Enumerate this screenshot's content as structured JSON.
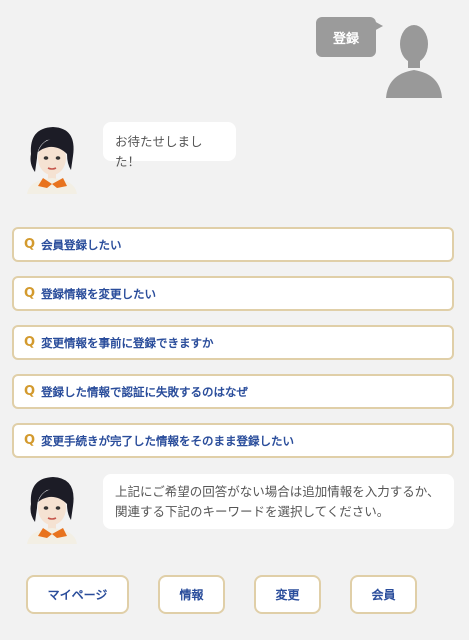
{
  "user_message": "登録",
  "bot_messages": [
    "お待たせしました！",
    "上記にご希望の回答がない場合は追加情報を入力するか、関連する下記のキーワードを選択してください。"
  ],
  "q_mark": "Q",
  "questions": [
    "会員登録したい",
    "登録情報を変更したい",
    "変更情報を事前に登録できますか",
    "登録した情報で認証に失敗するのはなぜ",
    "変更手続きが完了した情報をそのまま登録したい"
  ],
  "keywords": [
    "マイページ",
    "情報",
    "変更",
    "会員"
  ],
  "colors": {
    "accent_text": "#2a4d9b",
    "q_mark": "#d39a2e",
    "border": "#e0cfa8",
    "user_bubble": "#9b9b9b"
  },
  "icons": {
    "user": "user-silhouette-icon",
    "bot": "operator-avatar-icon"
  }
}
